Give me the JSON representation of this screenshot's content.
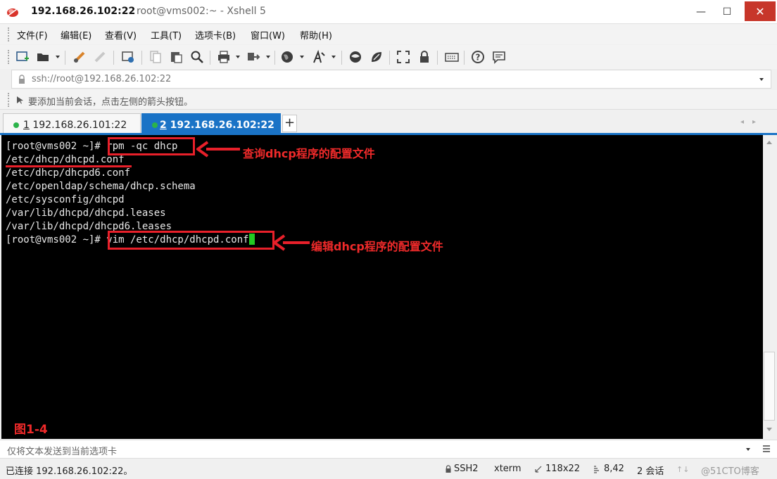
{
  "window": {
    "host_title": "192.168.26.102:22",
    "title_rest": "root@vms002:~ - Xshell 5",
    "minimize": "—",
    "maximize": "☐",
    "close": "✕"
  },
  "menu": [
    "文件(F)",
    "编辑(E)",
    "查看(V)",
    "工具(T)",
    "选项卡(B)",
    "窗口(W)",
    "帮助(H)"
  ],
  "toolbar_icons": [
    "new-session-icon",
    "open-folder-icon",
    "connect-icon",
    "disconnect-icon",
    "properties-icon",
    "copy-icon",
    "paste-icon",
    "find-icon",
    "print-icon",
    "transfer-icon",
    "globe-icon",
    "font-icon",
    "xftp-icon",
    "xmanager-icon",
    "fullscreen-icon",
    "lock-icon",
    "keyboard-icon",
    "help-icon",
    "chat-icon"
  ],
  "address": {
    "value": "ssh://root@192.168.26.102:22"
  },
  "hint": {
    "text": "要添加当前会话，点击左侧的箭头按钮。"
  },
  "tabs": [
    {
      "num": "1",
      "label": " 192.168.26.101:22",
      "active": false,
      "status_color": "#2bb34a"
    },
    {
      "num": "2",
      "label": " 192.168.26.102:22",
      "active": true,
      "status_color": "#2bb34a"
    }
  ],
  "tab_add": "+",
  "tab_scroll": "◂▸",
  "terminal": {
    "lines": [
      "[root@vms002 ~]# rpm -qc dhcp",
      "/etc/dhcp/dhcpd.conf",
      "/etc/dhcp/dhcpd6.conf",
      "/etc/openldap/schema/dhcp.schema",
      "/etc/sysconfig/dhcpd",
      "/var/lib/dhcpd/dhcpd.leases",
      "/var/lib/dhcpd/dhcpd6.leases",
      "[root@vms002 ~]# vim /etc/dhcp/dhcpd.conf"
    ],
    "annotation_1": "查询dhcp程序的配置文件",
    "annotation_2": "编辑dhcp程序的配置文件",
    "figure_label": "图1-4",
    "accent_color": "#e8202a",
    "cursor_color": "#22c922"
  },
  "compose": {
    "placeholder": "仅将文本发送到当前选项卡"
  },
  "status": {
    "connected": "已连接 192.168.26.102:22。",
    "protocol": "SSH2",
    "term": "xterm",
    "size": "118x22",
    "cursor_pos": "8,42",
    "sessions": "2 会话",
    "watermark": "@51CTO博客"
  }
}
